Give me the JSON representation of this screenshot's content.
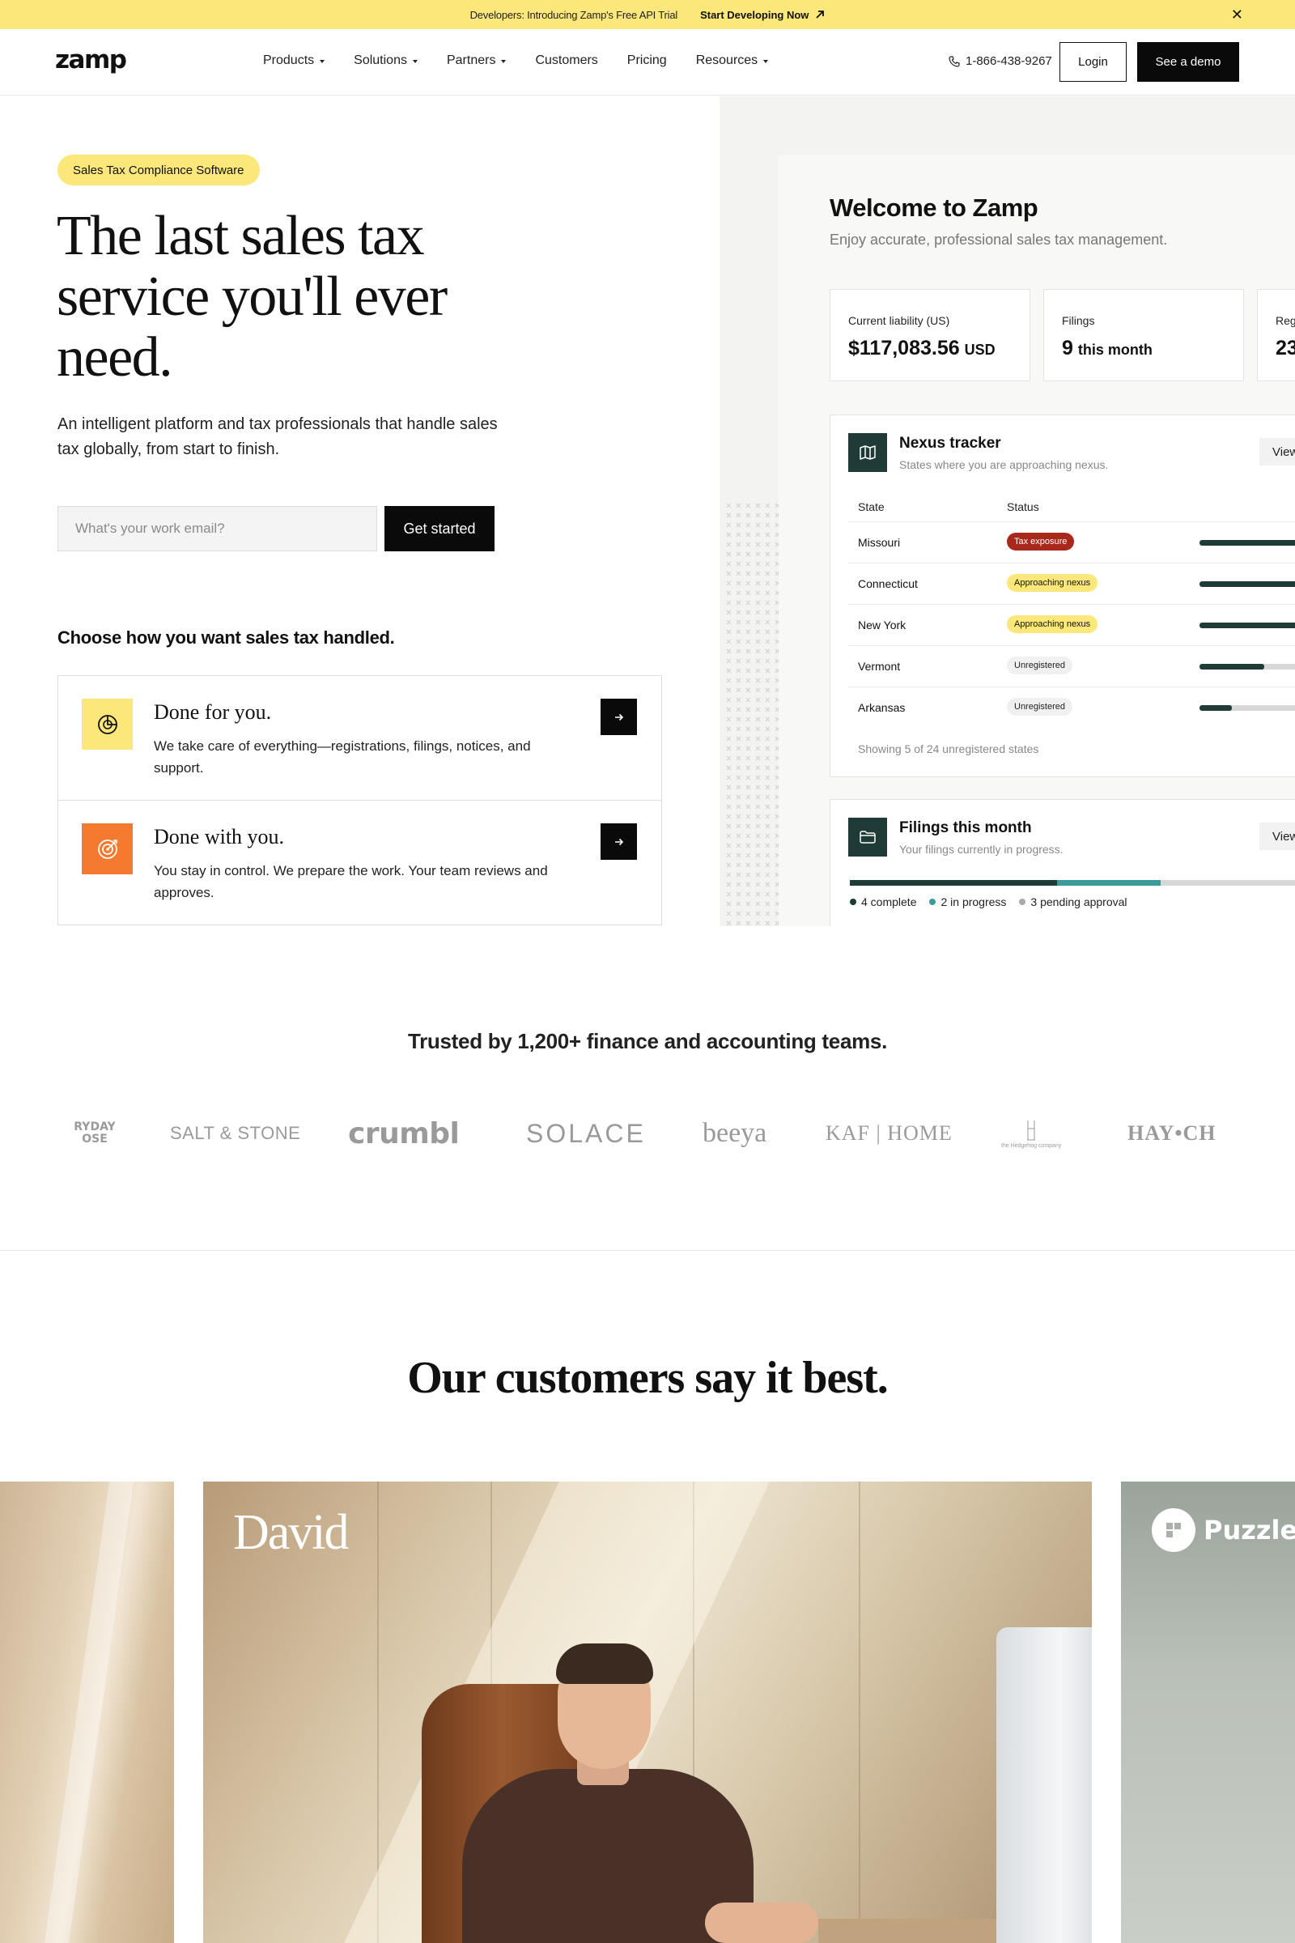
{
  "announcement": {
    "message": "Developers: Introducing Zamp's Free API Trial",
    "cta": "Start Developing Now"
  },
  "nav": {
    "logo": "zamp",
    "links": [
      "Products",
      "Solutions",
      "Partners",
      "Customers",
      "Pricing",
      "Resources"
    ],
    "phone": "1-866-438-9267",
    "login": "Login",
    "demo": "See a demo"
  },
  "hero": {
    "badge": "Sales Tax Compliance Software",
    "title": "The last sales tax service you'll ever need.",
    "subtitle": "An intelligent platform and tax professionals that handle sales tax globally, from start to finish.",
    "email_placeholder": "What's your work email?",
    "cta": "Get started",
    "choose_heading": "Choose how you want sales tax handled.",
    "choices": [
      {
        "title": "Done for you.",
        "desc": "We take care of everything—registrations, filings, notices, and support."
      },
      {
        "title": "Done with you.",
        "desc": "You stay in control. We prepare the work. Your team reviews and approves."
      }
    ]
  },
  "dashboard": {
    "welcome": "Welcome to Zamp",
    "welcome_sub": "Enjoy accurate, professional sales tax management.",
    "stats": [
      {
        "label": "Current liability (US)",
        "value": "$117,083.56",
        "unit": "USD"
      },
      {
        "label": "Filings",
        "value": "9",
        "unit": "this month"
      },
      {
        "label": "Reg",
        "value": "23",
        "unit": ""
      }
    ],
    "nexus": {
      "title": "Nexus tracker",
      "subtitle": "States where you are approaching nexus.",
      "view": "View",
      "col_state": "State",
      "col_status": "Status",
      "rows": [
        {
          "state": "Missouri",
          "status": "Tax exposure",
          "kind": "red",
          "progress": 1.0
        },
        {
          "state": "Connecticut",
          "status": "Approaching nexus",
          "kind": "yellow",
          "progress": 1.0
        },
        {
          "state": "New York",
          "status": "Approaching nexus",
          "kind": "yellow",
          "progress": 0.85
        },
        {
          "state": "Vermont",
          "status": "Unregistered",
          "kind": "gray",
          "progress": 0.5
        },
        {
          "state": "Arkansas",
          "status": "Unregistered",
          "kind": "gray",
          "progress": 0.25
        }
      ],
      "footer": "Showing 5 of 24 unregistered states"
    },
    "filings": {
      "title": "Filings this month",
      "subtitle": "Your filings currently in progress.",
      "view": "View",
      "complete": 4,
      "in_progress": 2,
      "pending": 3,
      "legend": [
        "4 complete",
        "2 in progress",
        "3 pending approval"
      ],
      "colors": {
        "complete": "#1e3b37",
        "in_progress": "#3a9b9a",
        "pending": "#d7d7d7"
      }
    }
  },
  "trusted": {
    "heading": "Trusted by 1,200+ finance and accounting teams.",
    "logos": {
      "everyday_1": "RYDAY",
      "everyday_2": "OSE",
      "salt": "SALT & STONE",
      "crumbl": "crumbl",
      "solace": "SOLACE",
      "beeya": "beeya",
      "kaf": "KAF | HOME",
      "hedge": "the Hedgehog company",
      "hay": "HAY•CH"
    }
  },
  "testimonials": {
    "heading": "Our customers say it best.",
    "featured_name": "David",
    "right_brand": "Puzzle"
  },
  "colors": {
    "accent_yellow": "#fbe77a",
    "dark": "#0a0a0a",
    "teal_dark": "#1e3b37",
    "orange": "#f37a2e",
    "red": "#a8281c"
  }
}
